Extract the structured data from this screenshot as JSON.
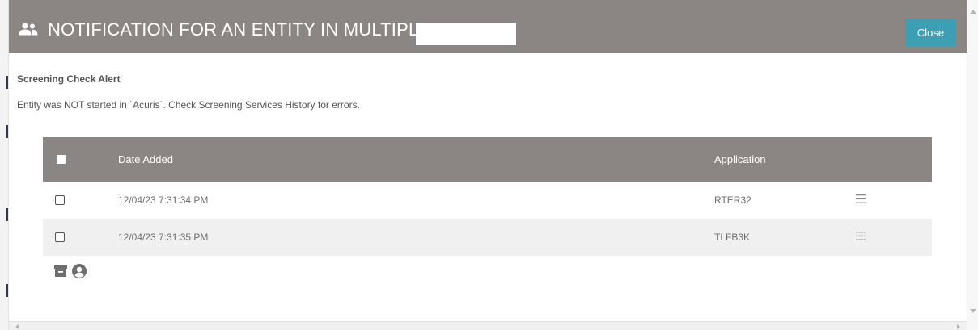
{
  "header": {
    "title": "NOTIFICATION FOR AN ENTITY IN MULTIPL",
    "icon": "people-icon",
    "close_label": "Close",
    "bg_color": "#8b8683",
    "accent_color": "#3d9fb3"
  },
  "alert": {
    "title": "Screening Check Alert",
    "message": "Entity was NOT started in `Acuris`. Check Screening Services History for errors."
  },
  "grid": {
    "columns": [
      "Date Added",
      "Application"
    ],
    "rows": [
      {
        "date_added": "12/04/23 7:31:34 PM",
        "application": "RTER32",
        "checked": false
      },
      {
        "date_added": "12/04/23 7:31:35 PM",
        "application": "TLFB3K",
        "checked": false
      }
    ],
    "row_menu_icon": "menu-icon"
  },
  "footer": {
    "icons": [
      "archive-icon",
      "user-circle-icon"
    ]
  }
}
